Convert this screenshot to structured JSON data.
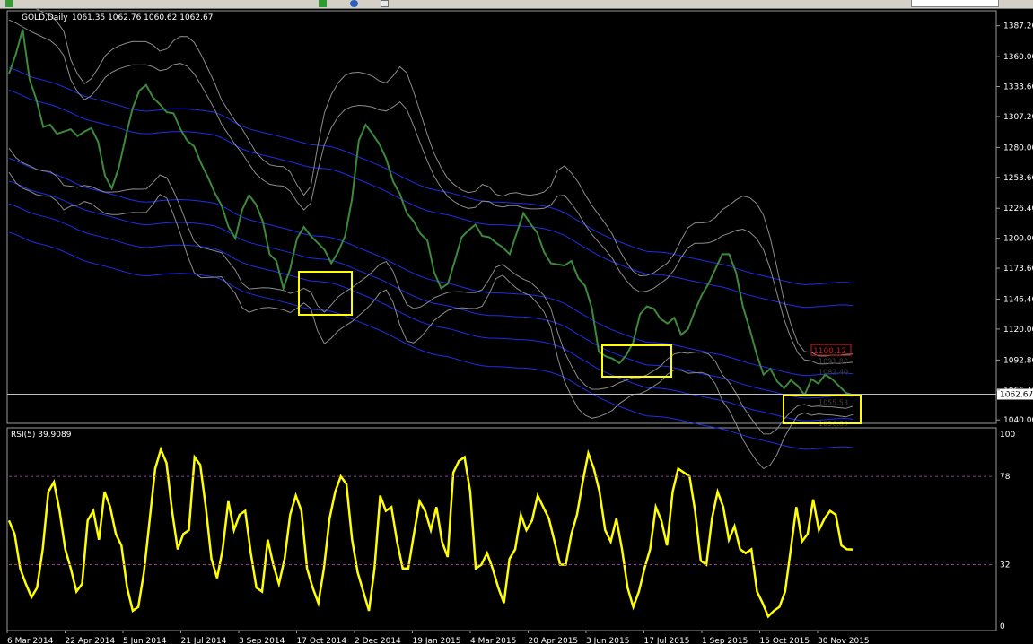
{
  "toolbar": {
    "icons": [
      "app-icon",
      "add-icon",
      "refresh-icon",
      "window-icon"
    ]
  },
  "colors": {
    "background": "#000000",
    "price_bars": "#3c8a3c",
    "bands_blue": "#1f2de6",
    "bands_gray": "#8c8c8c",
    "rsi_line": "#ffff00",
    "highlight_box": "#ffff00",
    "current_price_line": "#c0c0c0",
    "level_marker": "#c81e1e",
    "rsi_levels": "#8c3c8c"
  },
  "chart_data": [
    {
      "type": "line",
      "symbol_header": "GOLD,Daily",
      "ohlc_header": "1061.35 1062.76 1060.62 1062.67",
      "series": [
        {
          "values": [
            1345,
            1362,
            1384,
            1340,
            1322,
            1298,
            1300,
            1292,
            1294,
            1296,
            1290,
            1294,
            1297,
            1285,
            1255,
            1244,
            1262,
            1289,
            1314,
            1330,
            1335,
            1324,
            1318,
            1311,
            1310,
            1296,
            1286,
            1281,
            1266,
            1254,
            1240,
            1229,
            1210,
            1200,
            1225,
            1238,
            1230,
            1215,
            1186,
            1180,
            1156,
            1173,
            1200,
            1210,
            1202,
            1196,
            1190,
            1178,
            1188,
            1202,
            1234,
            1286,
            1300,
            1292,
            1283,
            1270,
            1250,
            1239,
            1222,
            1215,
            1204,
            1198,
            1170,
            1156,
            1160,
            1180,
            1201,
            1207,
            1212,
            1202,
            1201,
            1196,
            1192,
            1186,
            1204,
            1222,
            1213,
            1205,
            1188,
            1178,
            1177,
            1176,
            1180,
            1165,
            1158,
            1138,
            1100,
            1096,
            1094,
            1090,
            1097,
            1108,
            1133,
            1140,
            1138,
            1129,
            1125,
            1130,
            1115,
            1120,
            1136,
            1150,
            1160,
            1173,
            1186,
            1186,
            1170,
            1140,
            1120,
            1098,
            1080,
            1085,
            1074,
            1068,
            1075,
            1070,
            1062,
            1076,
            1072,
            1080,
            1076,
            1070,
            1064,
            1062
          ]
        }
      ],
      "y_ticks": [
        "1387.20",
        "1360.00",
        "1333.60",
        "1307.20",
        "1280.00",
        "1253.60",
        "1226.40",
        "1200.00",
        "1173.60",
        "1146.40",
        "1120.00",
        "1092.80",
        "1066.40",
        "1040.00"
      ],
      "ylim": [
        1037,
        1398
      ],
      "current_price": "1062.67",
      "level_label": "1100.12",
      "ghost_labels": [
        "1091.80",
        "1082.40",
        "1055.53",
        "1036.89"
      ],
      "highlight_boxes": 4
    },
    {
      "type": "line",
      "indicator_header": "RSI(5) 39.9089",
      "series": [
        {
          "values": [
            55,
            48,
            30,
            22,
            15,
            20,
            40,
            70,
            75,
            60,
            40,
            30,
            18,
            22,
            55,
            60,
            45,
            70,
            62,
            48,
            42,
            20,
            8,
            10,
            28,
            55,
            82,
            92,
            85,
            60,
            40,
            48,
            50,
            88,
            84,
            62,
            35,
            25,
            40,
            65,
            50,
            58,
            60,
            38,
            20,
            18,
            45,
            32,
            22,
            35,
            58,
            68,
            60,
            30,
            20,
            12,
            30,
            56,
            70,
            78,
            74,
            45,
            28,
            18,
            8,
            30,
            68,
            60,
            62,
            44,
            30,
            30,
            48,
            65,
            60,
            50,
            62,
            44,
            36,
            80,
            86,
            88,
            70,
            30,
            32,
            38,
            30,
            20,
            12,
            35,
            40,
            58,
            50,
            55,
            68,
            62,
            56,
            44,
            32,
            32,
            48,
            58,
            75,
            90,
            82,
            70,
            50,
            44,
            56,
            40,
            20,
            10,
            18,
            30,
            40,
            62,
            55,
            42,
            70,
            82,
            80,
            78,
            60,
            34,
            32,
            56,
            70,
            62,
            45,
            52,
            40,
            38,
            40,
            18,
            12,
            5,
            8,
            10,
            18,
            40,
            62,
            44,
            48,
            66,
            50,
            56,
            60,
            58,
            42,
            40,
            39.9
          ]
        }
      ],
      "y_ticks": [
        "100",
        "78",
        "32",
        "0"
      ],
      "ylim": [
        0,
        100
      ],
      "levels": [
        78,
        32
      ]
    }
  ],
  "x_axis": {
    "labels": [
      "6 Mar 2014",
      "22 Apr 2014",
      "5 Jun 2014",
      "21 Jul 2014",
      "3 Sep 2014",
      "17 Oct 2014",
      "2 Dec 2014",
      "19 Jan 2015",
      "4 Mar 2015",
      "20 Apr 2015",
      "3 Jun 2015",
      "17 Jul 2015",
      "1 Sep 2015",
      "15 Oct 2015",
      "30 Nov 2015"
    ]
  }
}
